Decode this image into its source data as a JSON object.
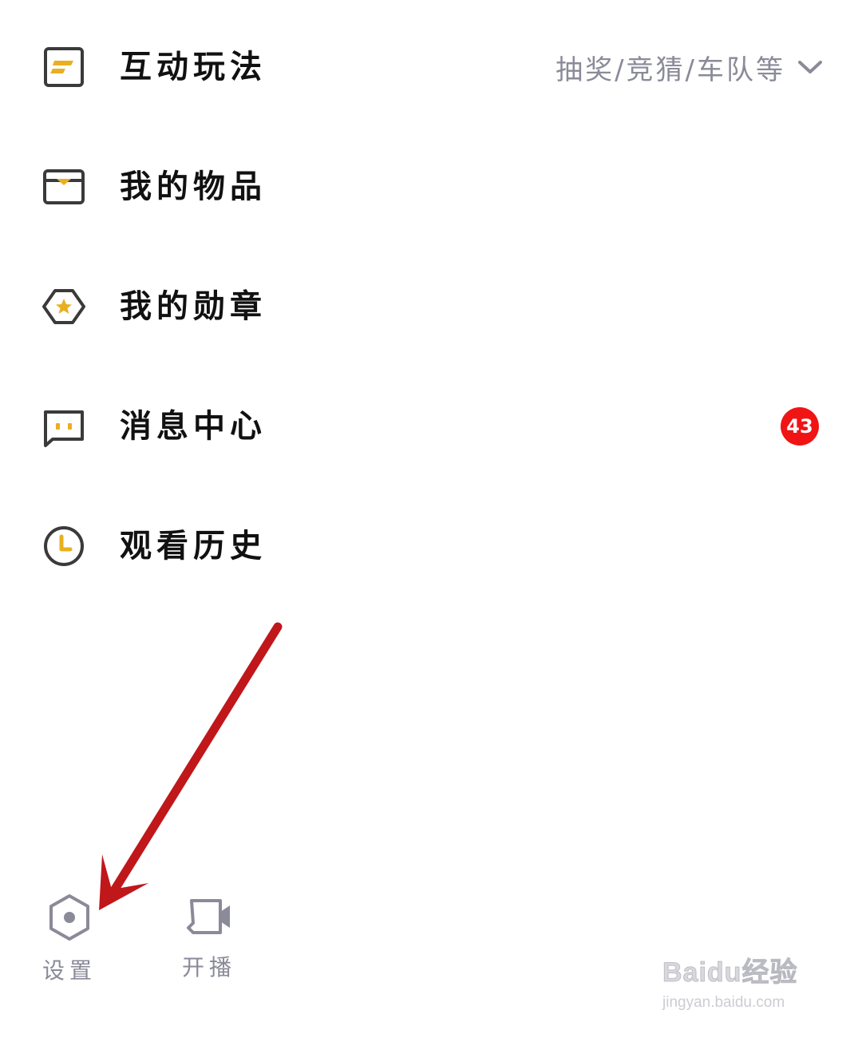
{
  "menu": {
    "items": [
      {
        "id": "interactive",
        "label": "互动玩法",
        "icon": "interactive-play-icon",
        "extra": "抽奖/竞猜/车队等"
      },
      {
        "id": "items",
        "label": "我的物品",
        "icon": "gift-box-icon"
      },
      {
        "id": "badges",
        "label": "我的勋章",
        "icon": "medal-hexagon-star-icon"
      },
      {
        "id": "messages",
        "label": "消息中心",
        "icon": "message-bubble-icon",
        "badge": "43"
      },
      {
        "id": "history",
        "label": "观看历史",
        "icon": "clock-icon"
      }
    ]
  },
  "bottom": {
    "settings_label": "设置",
    "broadcast_label": "开播"
  },
  "annotation": {
    "arrow_color": "#c0171b",
    "points_to": "settings"
  },
  "watermark": {
    "brand": "Baidu经验",
    "url": "jingyan.baidu.com"
  },
  "colors": {
    "accent_gold": "#e8b020",
    "icon_outline": "#3a3a3a",
    "secondary_text": "#8a8a99",
    "badge_red": "#f01414"
  }
}
